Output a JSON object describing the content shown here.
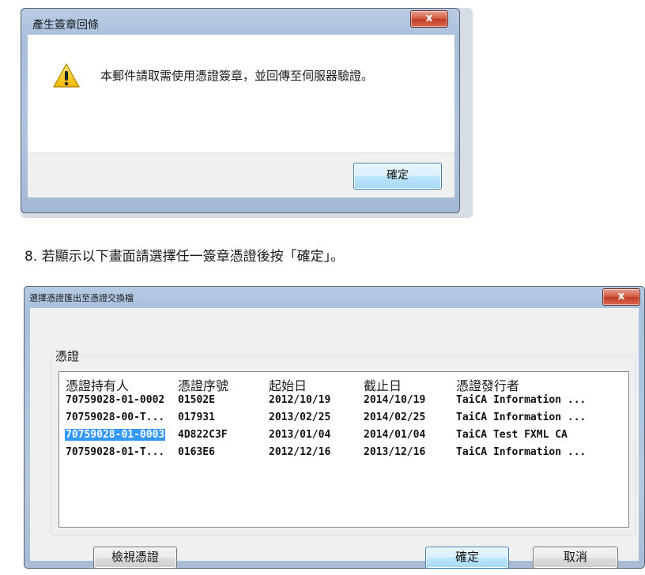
{
  "dialog1": {
    "title": "產生簽章回條",
    "close_label": "x",
    "message": "本郵件請取需使用憑證簽章，並回傳至伺服器驗證。",
    "ok_label": "確定",
    "warning_icon": "warning-icon"
  },
  "step_text": "8.  若顯示以下畫面請選擇任一簽章憑證後按「確定」。",
  "dialog2": {
    "title": "選擇憑證匯出至憑證交換檔",
    "close_label": "x",
    "group_label": "憑證",
    "columns": [
      "憑證持有人",
      "憑證序號",
      "起始日",
      "截止日",
      "憑證發行者"
    ],
    "rows": [
      [
        "70759028-01-0002",
        "01502E",
        "2012/10/19",
        "2014/10/19",
        "TaiCA Information ..."
      ],
      [
        "70759028-00-T...",
        "017931",
        "2013/02/25",
        "2014/02/25",
        "TaiCA Information ..."
      ],
      [
        "70759028-01-0003",
        "4D822C3F",
        "2013/01/04",
        "2014/01/04",
        "TaiCA Test FXML CA"
      ],
      [
        "70759028-01-T...",
        "0163E6",
        "2012/12/16",
        "2013/12/16",
        "TaiCA Information ..."
      ]
    ],
    "selected_row": 2,
    "view_label": "檢視憑證",
    "ok_label": "確定",
    "cancel_label": "取消",
    "selection_color": "#3399ff"
  }
}
